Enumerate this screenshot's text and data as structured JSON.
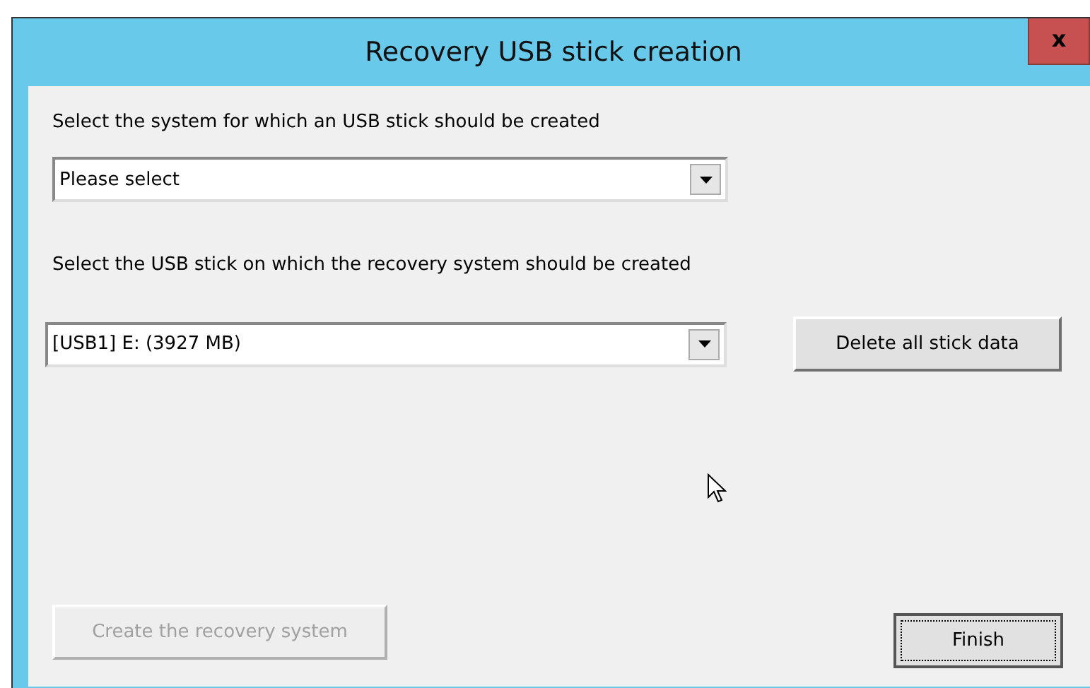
{
  "window": {
    "title": "Recovery USB stick creation",
    "close": "x"
  },
  "system_select": {
    "label": "Select the system for which an USB stick should be created",
    "value": "Please select"
  },
  "stick_select": {
    "label": "Select the USB stick on which the recovery system should be created",
    "value": "[USB1] E: (3927 MB)"
  },
  "delete_button": {
    "label": "Delete all stick data",
    "disabled": false,
    "focused": false
  },
  "create_button": {
    "label": "Create the recovery system",
    "disabled": true,
    "focused": false
  },
  "finish_button": {
    "label": "Finish",
    "disabled": false,
    "focused": true
  }
}
